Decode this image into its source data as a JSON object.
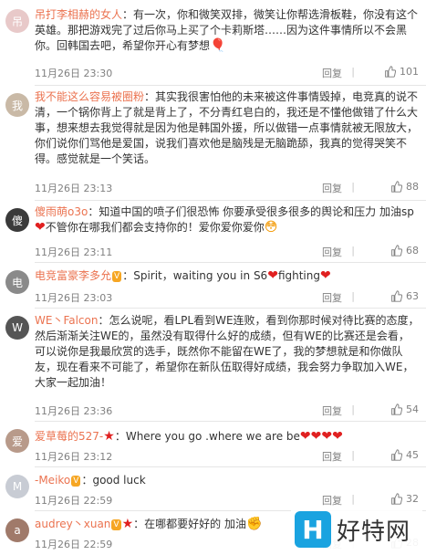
{
  "comments": [
    {
      "username": "吊打李相赫的女人",
      "separator": "：",
      "text": "有一次，你和微笑双排，微笑让你帮选滑板鞋，你没有这个英雄。那把游戏完了过后你马上买了个卡莉斯塔……因为这件事情所以不会黑你。回韩国去吧，希望你开心有梦想",
      "emoji_icon": "gift-icon",
      "time": "11月26日 23:30",
      "reply_label": "回复",
      "likes": "101",
      "avatar_color": "#e8c9c9",
      "avatar_initial": "吊"
    },
    {
      "username": "我不能这么容易被圈粉",
      "separator": "：",
      "text": "其实我很害怕他的未来被这件事情毁掉，电竞真的说不清，一个锅你背上了就是背上了，不分青红皂白的，我还是不懂他做错了什么大事，想来想去我觉得就是因为他是韩国外援，所以做错一点事情就被无限放大，你们说你们骂他是爱国，说我们喜欢他是脑残是无脑跪舔，我真的觉得哭笑不得。感觉就是一个笑话。",
      "time": "11月26日 23:13",
      "reply_label": "回复",
      "likes": "88",
      "avatar_color": "#c9b9a6",
      "avatar_initial": "我"
    },
    {
      "username": "傻雨萌o3o",
      "separator": "：",
      "text": "知道中国的喷子们很恐怖 你要承受很多很多的舆论和压力 加油sp",
      "text2": "不管你在哪我们都会支持你的！爱你爱你爱你",
      "time": "11月26日 23:11",
      "reply_label": "回复",
      "likes": "68",
      "avatar_color": "#3a3a3a",
      "avatar_initial": "傻"
    },
    {
      "username": "电竞富豪李多允",
      "separator": "：",
      "text": "Spirit，waiting you in S6",
      "text2": "fighting",
      "time": "11月26日 23:03",
      "reply_label": "回复",
      "likes": "63",
      "avatar_color": "#8a8a8a",
      "avatar_initial": "电"
    },
    {
      "username": "WE丶Falcon",
      "separator": "：",
      "text": "怎么说呢，看LPL看到WE连败，看到你那时候对待比赛的态度，然后渐渐关注WE的，虽然没有取得什么好的成绩，但有WE的比赛还是会看，可以说你是我最欣赏的选手，既然你不能留在WE了，我的梦想就是和你做队友，现在看来不可能了，希望你在新队伍取得好成绩，我会努力争取加入WE，大家一起加油！",
      "time": "11月26日 23:36",
      "reply_label": "回复",
      "likes": "54",
      "avatar_color": "#555555",
      "avatar_initial": "W"
    },
    {
      "username": "爱草莓的527-",
      "separator": "：",
      "text": "Where you go .where we are be",
      "time": "11月26日 23:12",
      "reply_label": "回复",
      "likes": "45",
      "avatar_color": "#b89a8a",
      "avatar_initial": "爱"
    },
    {
      "username": "-Meiko",
      "separator": "：",
      "text": "good luck",
      "time": "11月26日 22:59",
      "reply_label": "回复",
      "likes": "32",
      "avatar_color": "#c8ccd4",
      "avatar_initial": "M"
    },
    {
      "username": "audrey丶xuan",
      "separator": "：",
      "text": "在哪都要好好的 加油",
      "time": "11月26日 22:59",
      "reply_label": "回复",
      "likes": "28",
      "avatar_color": "#a07a6a",
      "avatar_initial": "a"
    }
  ],
  "watermark": {
    "logo_letter": "H",
    "site_name": "好特网"
  }
}
